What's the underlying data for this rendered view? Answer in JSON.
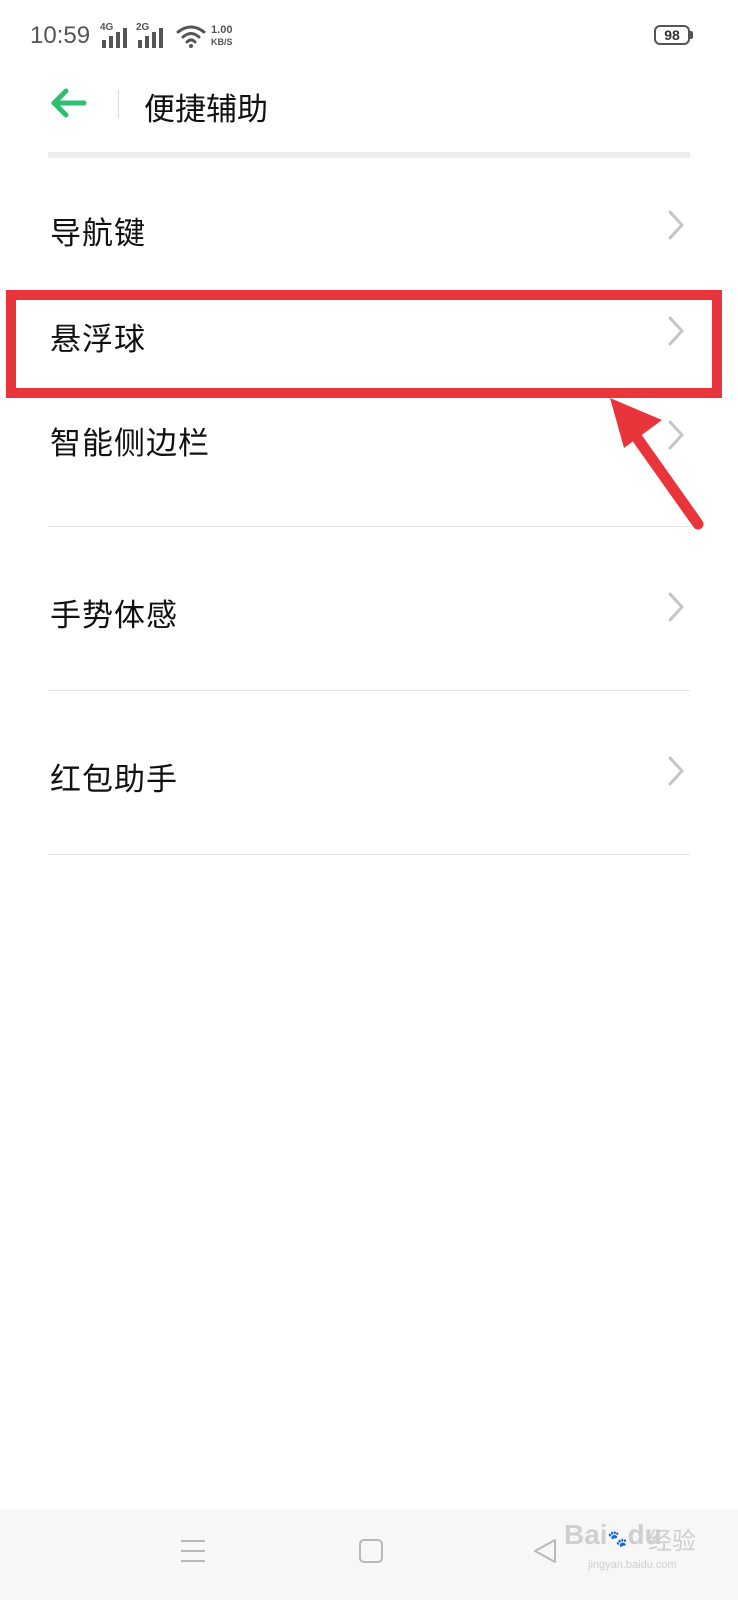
{
  "status_bar": {
    "time": "10:59",
    "net1": "4G",
    "net2": "2G",
    "speed_value": "1.00",
    "speed_unit": "KB/S",
    "battery": "98"
  },
  "header": {
    "title": "便捷辅助"
  },
  "menu": {
    "items": [
      {
        "label": "导航键"
      },
      {
        "label": "悬浮球"
      },
      {
        "label": "智能侧边栏"
      },
      {
        "label": "手势体感"
      },
      {
        "label": "红包助手"
      }
    ]
  },
  "annotation": {
    "highlighted_item": "悬浮球",
    "color": "#e8343a"
  },
  "watermark": {
    "brand": "Bai",
    "brand2": "du",
    "suffix": "经验",
    "url": "jingyan.baidu.com"
  },
  "colors": {
    "accent": "#2fbf71",
    "chevron": "#c4c4c4"
  }
}
